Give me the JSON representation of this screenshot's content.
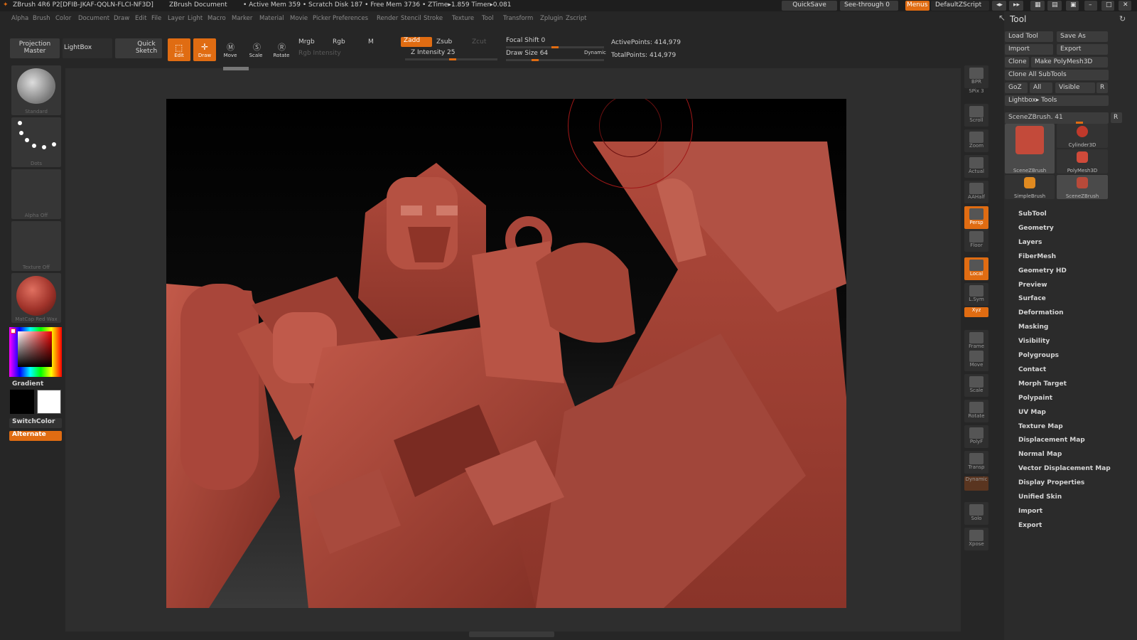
{
  "app_title": "ZBrush 4R6 P2[DFIB-JKAF-QQLN-FLCI-NF3D]",
  "doc_title": "ZBrush Document",
  "stats": "• Active Mem 359 • Scratch Disk 187 • Free Mem 3736 • ZTime▸1.859 Timer▸0.081",
  "top_buttons": {
    "quicksave": "QuickSave",
    "see_through": "See-through",
    "see_through_value": "0",
    "menus": "Menus",
    "script": "DefaultZScript"
  },
  "menus": [
    "Alpha",
    "Brush",
    "Color",
    "Document",
    "Draw",
    "Edit",
    "File",
    "Layer",
    "Light",
    "Macro",
    "Marker",
    "Material",
    "Movie",
    "Picker",
    "Preferences",
    "Render",
    "Stencil",
    "Stroke",
    "Texture",
    "Tool",
    "Transform",
    "Zplugin",
    "Zscript"
  ],
  "shelf": {
    "projection_master": "Projection Master",
    "lightbox": "LightBox",
    "quick_sketch": "Quick Sketch",
    "edit": "Edit",
    "draw": "Draw",
    "move": "Move",
    "scale": "Scale",
    "rotate": "Rotate",
    "mrgb": "Mrgb",
    "rgb": "Rgb",
    "m": "M",
    "rgb_intensity": "Rgb Intensity",
    "zadd": "Zadd",
    "zsub": "Zsub",
    "zcut": "Zcut",
    "z_intensity": "Z Intensity 25",
    "focal_shift": "Focal Shift 0",
    "draw_size": "Draw Size 64",
    "dynamic": "Dynamic",
    "active_points": "ActivePoints: 414,979",
    "total_points": "TotalPoints: 414,979"
  },
  "left": {
    "standard": "Standard",
    "dots": "Dots",
    "alpha": "Alpha Off",
    "texture": "Texture Off",
    "material": "MatCap Red Wax",
    "gradient": "Gradient",
    "switch_color": "SwitchColor",
    "alternate": "Alternate"
  },
  "right_tools": [
    "BPR",
    "SPix 3",
    "Scroll",
    "Zoom",
    "Actual",
    "AAHalf",
    "Persp",
    "Floor",
    "Local",
    "L.Sym",
    "Xyz",
    "Frame",
    "Move",
    "Scale",
    "Rotate",
    "PolyF",
    "Transp",
    "Dynamic",
    "Solo",
    "Xpose"
  ],
  "tool_panel": {
    "title": "Tool",
    "buttons": [
      "Load Tool",
      "Save As",
      "Import",
      "Export",
      "Clone",
      "Make PolyMesh3D",
      "Clone All SubTools",
      "GoZ",
      "All",
      "Visible",
      "R",
      "Lightbox▸ Tools"
    ],
    "scene_slider": "SceneZBrush. 41",
    "scene_slider_r": "R",
    "thumbs": [
      "SceneZBrush",
      "Cylinder3D",
      "PolyMesh3D",
      "SimpleBrush",
      "SceneZBrush"
    ],
    "sections": [
      "SubTool",
      "Geometry",
      "Layers",
      "FiberMesh",
      "Geometry HD",
      "Preview",
      "Surface",
      "Deformation",
      "Masking",
      "Visibility",
      "Polygroups",
      "Contact",
      "Morph Target",
      "Polypaint",
      "UV Map",
      "Texture Map",
      "Displacement Map",
      "Normal Map",
      "Vector Displacement Map",
      "Display Properties",
      "Unified Skin",
      "Import",
      "Export"
    ]
  },
  "colors": {
    "accent": "#e06c12",
    "model": "#a9463a"
  }
}
